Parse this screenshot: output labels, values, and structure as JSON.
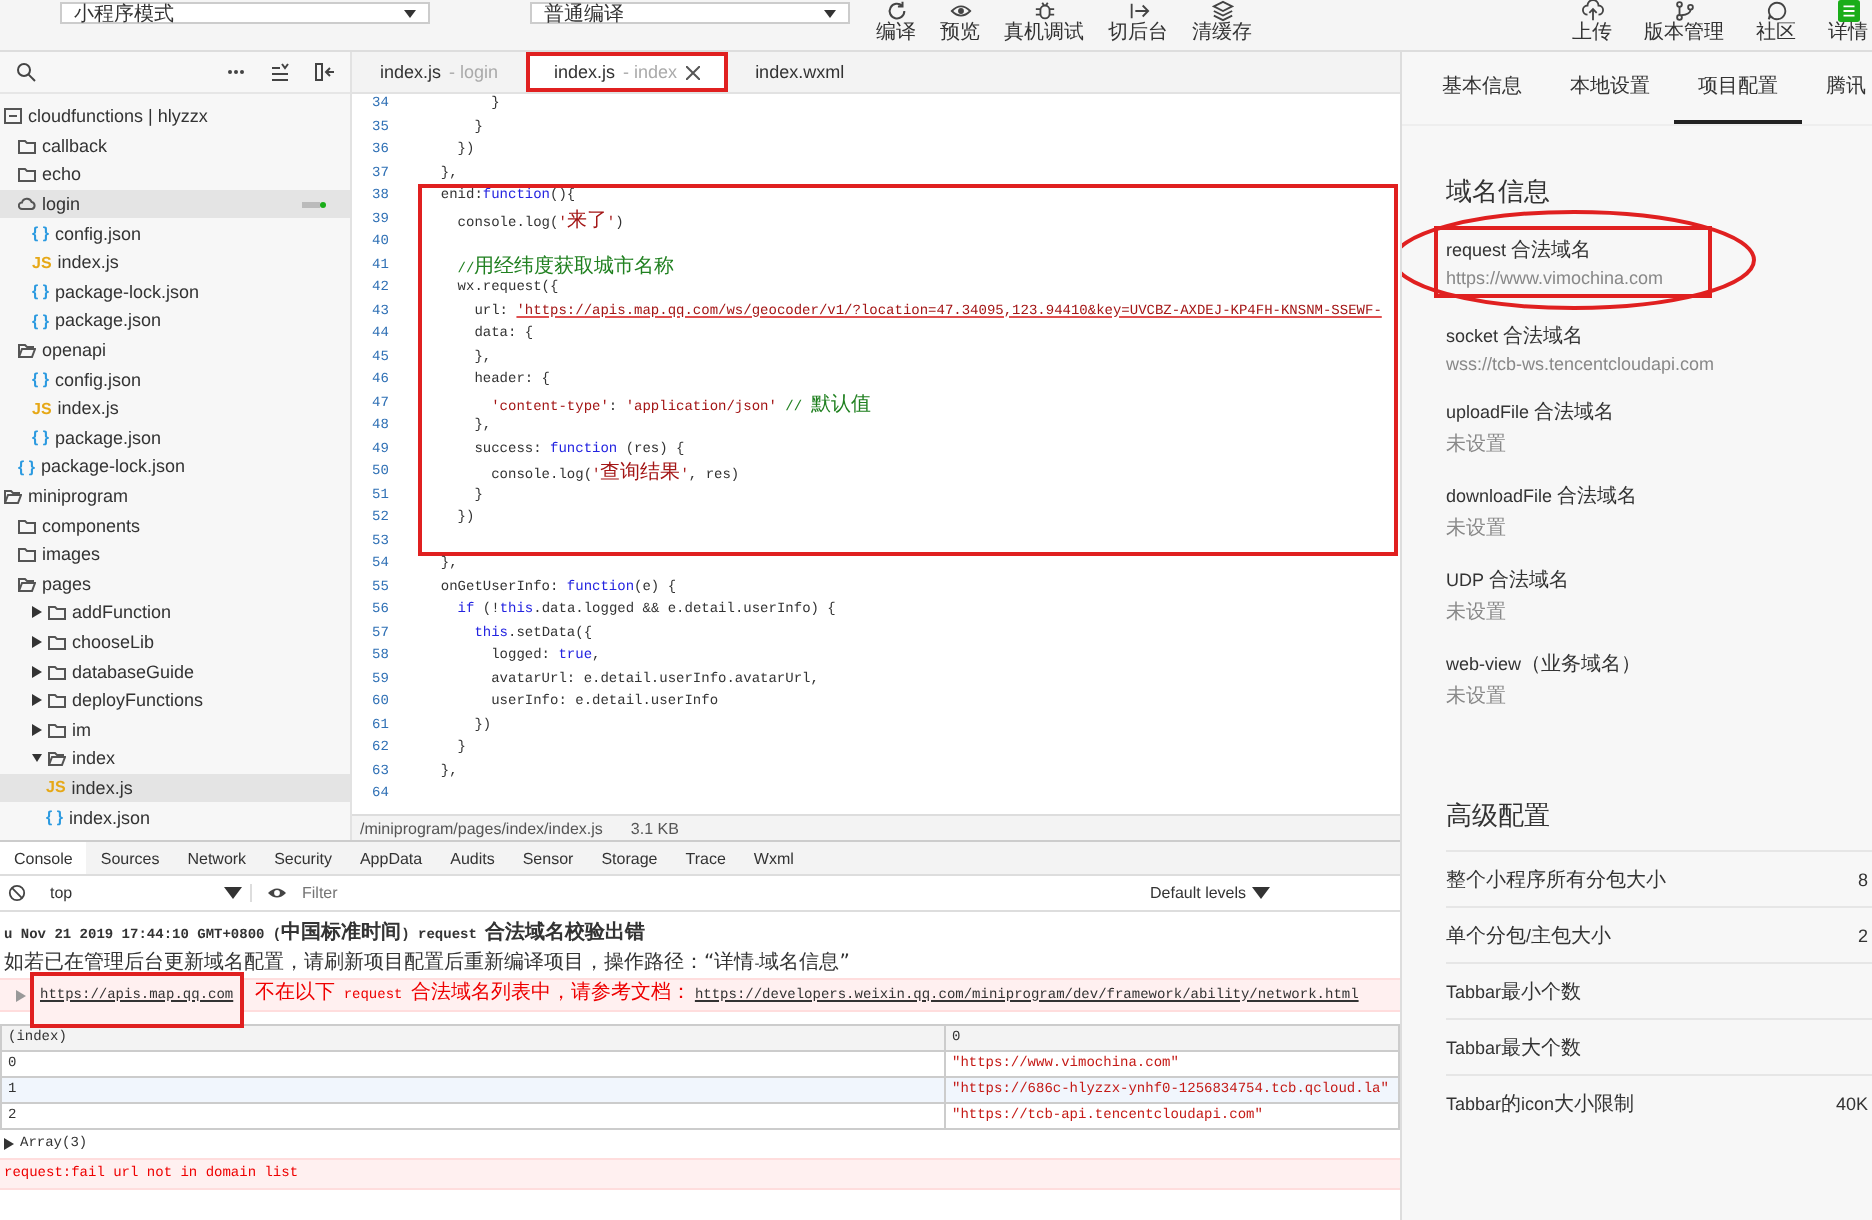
{
  "toolbar": {
    "dropdowns": [
      "小程序模式",
      "普通编译"
    ],
    "left_buttons": [
      "编译",
      "预览",
      "真机调试",
      "切后台",
      "清缓存"
    ],
    "right_buttons": [
      "上传",
      "版本管理",
      "社区",
      "详情"
    ]
  },
  "explorer": {
    "tree": [
      {
        "label": "cloudfunctions | hlyzzx",
        "kind": "root",
        "selected": false,
        "children": [
          {
            "label": "callback",
            "kind": "folder",
            "selected": false
          },
          {
            "label": "echo",
            "kind": "folder",
            "selected": false
          },
          {
            "label": "login",
            "kind": "cloud-folder",
            "selected": true,
            "runtime_badge": true,
            "children": [
              {
                "label": "config.json",
                "kind": "json",
                "icon": "{ }",
                "selected": false
              },
              {
                "label": "index.js",
                "kind": "js",
                "icon": "JS",
                "selected": false
              },
              {
                "label": "package-lock.json",
                "kind": "json",
                "icon": "{ }",
                "selected": false
              },
              {
                "label": "package.json",
                "kind": "json",
                "icon": "{ }",
                "selected": false
              }
            ]
          },
          {
            "label": "openapi",
            "kind": "open-folder",
            "selected": false,
            "children": [
              {
                "label": "config.json",
                "kind": "json",
                "icon": "{ }",
                "selected": false
              },
              {
                "label": "index.js",
                "kind": "js",
                "icon": "JS",
                "selected": false
              },
              {
                "label": "package.json",
                "kind": "json",
                "icon": "{ }",
                "selected": false
              }
            ]
          },
          {
            "label": "package-lock.json",
            "kind": "json",
            "icon": "{ }",
            "selected": false
          }
        ]
      },
      {
        "label": "miniprogram",
        "kind": "open-folder",
        "selected": false,
        "children": [
          {
            "label": "components",
            "kind": "folder",
            "selected": false
          },
          {
            "label": "images",
            "kind": "folder",
            "selected": false
          },
          {
            "label": "pages",
            "kind": "open-folder",
            "selected": false,
            "children": [
              {
                "label": "addFunction",
                "kind": "folder",
                "expanded": false,
                "selected": false
              },
              {
                "label": "chooseLib",
                "kind": "folder",
                "expanded": false,
                "selected": false
              },
              {
                "label": "databaseGuide",
                "kind": "folder",
                "expanded": false,
                "selected": false
              },
              {
                "label": "deployFunctions",
                "kind": "folder",
                "expanded": false,
                "selected": false
              },
              {
                "label": "im",
                "kind": "folder",
                "expanded": false,
                "selected": false
              },
              {
                "label": "index",
                "kind": "open-folder",
                "expanded": true,
                "selected": false,
                "children": [
                  {
                    "label": "index.js",
                    "kind": "js",
                    "icon": "JS",
                    "selected": true
                  },
                  {
                    "label": "index.json",
                    "kind": "json",
                    "icon": "{ }",
                    "selected": false
                  }
                ]
              }
            ]
          }
        ]
      }
    ]
  },
  "editor": {
    "tabs": [
      {
        "label": "index.js",
        "detail": "- login",
        "selected": false,
        "closable": false,
        "highlighted": false
      },
      {
        "label": "index.js",
        "detail": "- index",
        "selected": true,
        "closable": true,
        "highlighted": true
      },
      {
        "label": "index.wxml",
        "selected": false,
        "closable": false,
        "highlighted": false
      }
    ],
    "blocks": [
      {
        "highlighted": false,
        "lines": [
          {
            "number": "34",
            "segments": [
              {
                "text": "        }",
                "kind": "plain"
              }
            ]
          },
          {
            "number": "35",
            "segments": [
              {
                "text": "      }",
                "kind": "plain"
              }
            ]
          },
          {
            "number": "36",
            "segments": [
              {
                "text": "    })",
                "kind": "plain"
              }
            ]
          },
          {
            "number": "37",
            "segments": [
              {
                "text": "  },",
                "kind": "plain"
              }
            ]
          }
        ]
      },
      {
        "highlighted": true,
        "lines": [
          {
            "number": "38",
            "segments": [
              {
                "text": "  enid:",
                "kind": "plain"
              },
              {
                "text": "function",
                "kind": "keyword"
              },
              {
                "text": "(){",
                "kind": "plain"
              }
            ]
          },
          {
            "number": "39",
            "segments": [
              {
                "text": "    console.log(",
                "kind": "plain"
              },
              {
                "text": "'来了'",
                "kind": "string"
              },
              {
                "text": ")",
                "kind": "plain"
              }
            ]
          },
          {
            "number": "40"
          },
          {
            "number": "41",
            "segments": [
              {
                "text": "    //用经纬度获取城市名称",
                "kind": "comment"
              }
            ]
          },
          {
            "number": "42",
            "segments": [
              {
                "text": "    wx.request({",
                "kind": "plain"
              }
            ]
          },
          {
            "number": "43",
            "segments": [
              {
                "text": "      url: ",
                "kind": "plain"
              },
              {
                "text": "'https://apis.map.qq.com/ws/geocoder/v1/?location=47.34095,123.94410&key=UVCBZ-AXDEJ-KP4FH-KNSNM-SSEWF-",
                "kind": "url"
              }
            ]
          },
          {
            "number": "44",
            "segments": [
              {
                "text": "      data: {",
                "kind": "plain"
              }
            ]
          },
          {
            "number": "45",
            "segments": [
              {
                "text": "      },",
                "kind": "plain"
              }
            ]
          },
          {
            "number": "46",
            "segments": [
              {
                "text": "      header: {",
                "kind": "plain"
              }
            ]
          },
          {
            "number": "47",
            "segments": [
              {
                "text": "        'content-type'",
                "kind": "string"
              },
              {
                "text": ": ",
                "kind": "plain"
              },
              {
                "text": "'application/json'",
                "kind": "string"
              },
              {
                "text": " // 默认值",
                "kind": "comment"
              }
            ]
          },
          {
            "number": "48",
            "segments": [
              {
                "text": "      },",
                "kind": "plain"
              }
            ]
          },
          {
            "number": "49",
            "segments": [
              {
                "text": "      success: ",
                "kind": "plain"
              },
              {
                "text": "function",
                "kind": "keyword"
              },
              {
                "text": " (res) {",
                "kind": "plain"
              }
            ]
          },
          {
            "number": "50",
            "segments": [
              {
                "text": "        console.log(",
                "kind": "plain"
              },
              {
                "text": "'查询结果'",
                "kind": "string"
              },
              {
                "text": ", res)",
                "kind": "plain"
              }
            ]
          },
          {
            "number": "51",
            "segments": [
              {
                "text": "      }",
                "kind": "plain"
              }
            ]
          },
          {
            "number": "52",
            "segments": [
              {
                "text": "    })",
                "kind": "plain"
              }
            ]
          },
          {
            "number": "53"
          }
        ]
      },
      {
        "highlighted": false,
        "lines": [
          {
            "number": "54",
            "segments": [
              {
                "text": "  },",
                "kind": "plain"
              }
            ]
          },
          {
            "number": "55",
            "segments": [
              {
                "text": "  onGetUserInfo: ",
                "kind": "plain"
              },
              {
                "text": "function",
                "kind": "keyword"
              },
              {
                "text": "(e) {",
                "kind": "plain"
              }
            ]
          },
          {
            "number": "56",
            "segments": [
              {
                "text": "    if",
                "kind": "keyword"
              },
              {
                "text": " (!",
                "kind": "plain"
              },
              {
                "text": "this",
                "kind": "keyword"
              },
              {
                "text": ".data.logged && e.detail.userInfo) {",
                "kind": "plain"
              }
            ]
          },
          {
            "number": "57",
            "segments": [
              {
                "text": "      this",
                "kind": "keyword"
              },
              {
                "text": ".setData({",
                "kind": "plain"
              }
            ]
          },
          {
            "number": "58",
            "segments": [
              {
                "text": "        logged: ",
                "kind": "plain"
              },
              {
                "text": "true",
                "kind": "keyword"
              },
              {
                "text": ",",
                "kind": "plain"
              }
            ]
          },
          {
            "number": "59",
            "segments": [
              {
                "text": "        avatarUrl: e.detail.userInfo.avatarUrl,",
                "kind": "plain"
              }
            ]
          },
          {
            "number": "60",
            "segments": [
              {
                "text": "        userInfo: e.detail.userInfo",
                "kind": "plain"
              }
            ]
          },
          {
            "number": "61",
            "segments": [
              {
                "text": "      })",
                "kind": "plain"
              }
            ]
          },
          {
            "number": "62",
            "segments": [
              {
                "text": "    }",
                "kind": "plain"
              }
            ]
          },
          {
            "number": "63",
            "segments": [
              {
                "text": "  },",
                "kind": "plain"
              }
            ]
          },
          {
            "number": "64"
          }
        ]
      }
    ],
    "status_bar": {
      "path": "/miniprogram/pages/index/index.js",
      "size": "3.1 KB"
    }
  },
  "console": {
    "tabs": [
      {
        "label": "Console",
        "selected": true
      },
      {
        "label": "Sources",
        "selected": false
      },
      {
        "label": "Network",
        "selected": false
      },
      {
        "label": "Security",
        "selected": false
      },
      {
        "label": "AppData",
        "selected": false
      },
      {
        "label": "Audits",
        "selected": false
      },
      {
        "label": "Sensor",
        "selected": false
      },
      {
        "label": "Storage",
        "selected": false
      },
      {
        "label": "Trace",
        "selected": false
      },
      {
        "label": "Wxml",
        "selected": false
      }
    ],
    "context": "top",
    "filter_placeholder": "Filter",
    "levels": "Default levels",
    "messages": [
      {
        "kind": "heading",
        "text": "u Nov 21 2019 17:44:10 GMT+0800 (中国标准时间) request 合法域名校验出错"
      },
      {
        "kind": "note",
        "text": "如若已在管理后台更新域名配置，请刷新项目配置后重新编译项目，操作路径：“详情-域名信息”"
      },
      {
        "kind": "error",
        "link": "https://apis.map.qq.com",
        "highlighted": true,
        "text": "不在以下 request 合法域名列表中，请参考文档：",
        "doc_link": "https://developers.weixin.qq.com/miniprogram/dev/framework/ability/network.html"
      },
      {
        "kind": "table",
        "columns": [
          "(index)",
          "0"
        ],
        "rows": [
          [
            "0",
            "\"https://www.vimochina.com\""
          ],
          [
            "1",
            "\"https://686c-hlyzzx-ynhf0-1256834754.tcb.qcloud.la\""
          ],
          [
            "2",
            "\"https://tcb-api.tencentcloudapi.com\""
          ]
        ]
      },
      {
        "kind": "object",
        "text": "Array(3)",
        "expanded": false
      },
      {
        "kind": "failure",
        "text": "request:fail url not in domain list"
      }
    ]
  },
  "details": {
    "tabs": [
      {
        "label": "基本信息",
        "selected": false
      },
      {
        "label": "本地设置",
        "selected": false
      },
      {
        "label": "项目配置",
        "selected": true
      },
      {
        "label": "腾讯",
        "selected": false
      }
    ],
    "domain_title": "域名信息",
    "domains": [
      {
        "name": "request 合法域名",
        "value": "https://www.vimochina.com",
        "highlighted": true
      },
      {
        "name": "socket 合法域名",
        "value": "wss://tcb-ws.tencentcloudapi.com",
        "highlighted": false
      },
      {
        "name": "uploadFile 合法域名",
        "value": "未设置",
        "highlighted": false
      },
      {
        "name": "downloadFile 合法域名",
        "value": "未设置",
        "highlighted": false
      },
      {
        "name": "UDP 合法域名",
        "value": "未设置",
        "highlighted": false
      },
      {
        "name": "web-view（业务域名）",
        "value": "未设置",
        "highlighted": false
      }
    ],
    "advanced_title": "高级配置",
    "advanced": [
      {
        "label": "整个小程序所有分包大小",
        "value": "8"
      },
      {
        "label": "单个分包/主包大小",
        "value": "2"
      },
      {
        "label": "Tabbar最小个数"
      },
      {
        "label": "Tabbar最大个数"
      },
      {
        "label": "Tabbar的icon大小限制",
        "value": "40K"
      }
    ]
  }
}
